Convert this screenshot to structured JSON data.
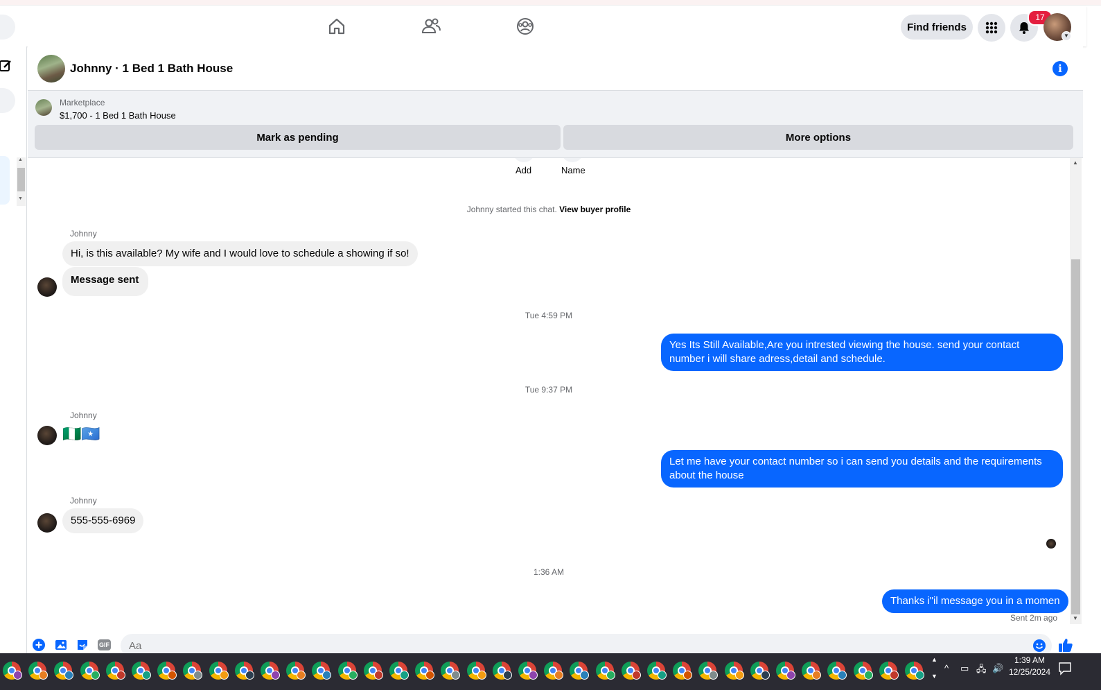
{
  "header": {
    "find_friends_label": "Find friends",
    "notification_count": "17"
  },
  "chat": {
    "title": "Johnny · 1 Bed 1 Bath House"
  },
  "marketplace": {
    "label": "Marketplace",
    "item": "$1,700 - 1 Bed 1 Bath House",
    "mark_pending_label": "Mark as pending",
    "more_options_label": "More options"
  },
  "thread": {
    "top_actions": [
      "Add",
      "Name"
    ],
    "started_text": "Johnny started this chat.",
    "view_profile_link": "View buyer profile",
    "messages": [
      {
        "sender": "Johnny",
        "text": "Hi, is this available? My wife and I would love to schedule a showing if so!"
      },
      {
        "text": "Message sent"
      },
      {
        "timestamp": "Tue 4:59 PM"
      },
      {
        "outgoing": true,
        "text": "Yes Its Still Available,Are you intrested viewing the house. send your contact number i will share adress,detail and schedule."
      },
      {
        "timestamp": "Tue 9:37 PM"
      },
      {
        "sender": "Johnny",
        "text": "🇳🇬🇸🇴"
      },
      {
        "outgoing": true,
        "text": "Let me have your contact number so i can send you details and the requirements about the house"
      },
      {
        "sender": "Johnny",
        "text": "555-555-6969"
      },
      {
        "timestamp": "1:36 AM"
      },
      {
        "outgoing": true,
        "text": "Thanks i\"il message you in a momen"
      }
    ],
    "sent_status": "Sent 2m ago"
  },
  "composer": {
    "placeholder": "Aa"
  },
  "taskbar": {
    "time": "1:39 AM",
    "date": "12/25/2024"
  },
  "colors": {
    "accent_blue": "#0866ff",
    "badge_red": "#e41e3f",
    "incoming_bubble": "#f0f0f0"
  }
}
